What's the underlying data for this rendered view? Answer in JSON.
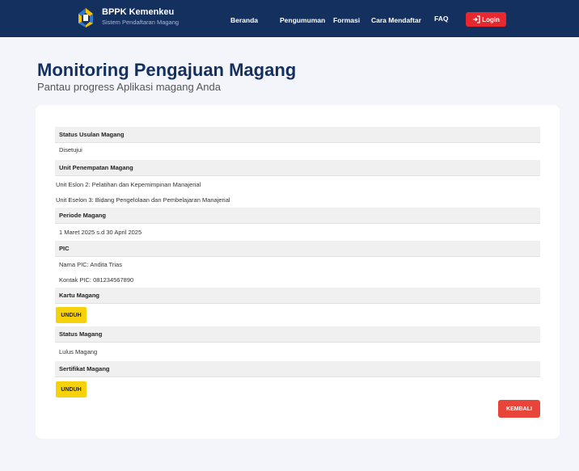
{
  "brand": {
    "title": "BPPK Kemenkeu",
    "subtitle": "Sistem Pendaftaran Magang"
  },
  "nav": {
    "beranda": "Beranda",
    "pengumuman": "Pengumuman",
    "formasi": "Formasi",
    "cara_mendaftar": "Cara Mendaftar",
    "faq": "FAQ",
    "login": "Login"
  },
  "page": {
    "title": "Monitoring Pengajuan Magang",
    "subtitle": "Pantau progress Aplikasi magang Anda"
  },
  "sections": {
    "status_usulan": {
      "label": "Status Usulan Magang",
      "value": "Disetujui"
    },
    "unit": {
      "label": "Unit Penempatan Magang",
      "eselon2": "Unit Eslon 2: Pelatihan dan Kepemimpinan Manajerial",
      "eselon3": "Unit Eselon 3: Bidang Pengelolaan dan Pembelajaran Manajerial"
    },
    "periode": {
      "label": "Periode Magang",
      "value": "1 Maret 2025 s.d 30 April 2025"
    },
    "pic": {
      "label": "PIC",
      "nama": "Nama PIC: Andita Trias",
      "kontak": "Kontak PIC: 081234567890"
    },
    "kartu": {
      "label": "Kartu Magang",
      "button": "UNDUH"
    },
    "status_magang": {
      "label": "Status Magang",
      "value": "Lulus Magang"
    },
    "sertifikat": {
      "label": "Sertifikat Magang",
      "button": "UNDUH"
    }
  },
  "actions": {
    "kembali": "KEMBALI"
  },
  "colors": {
    "navbar": "#14305f",
    "title": "#14305f",
    "login": "#e8282f",
    "unduh": "#f6d20a",
    "kembali": "#e8443a"
  },
  "icons": {
    "logo": "bppk-logo",
    "login": "login-arrow-icon"
  }
}
